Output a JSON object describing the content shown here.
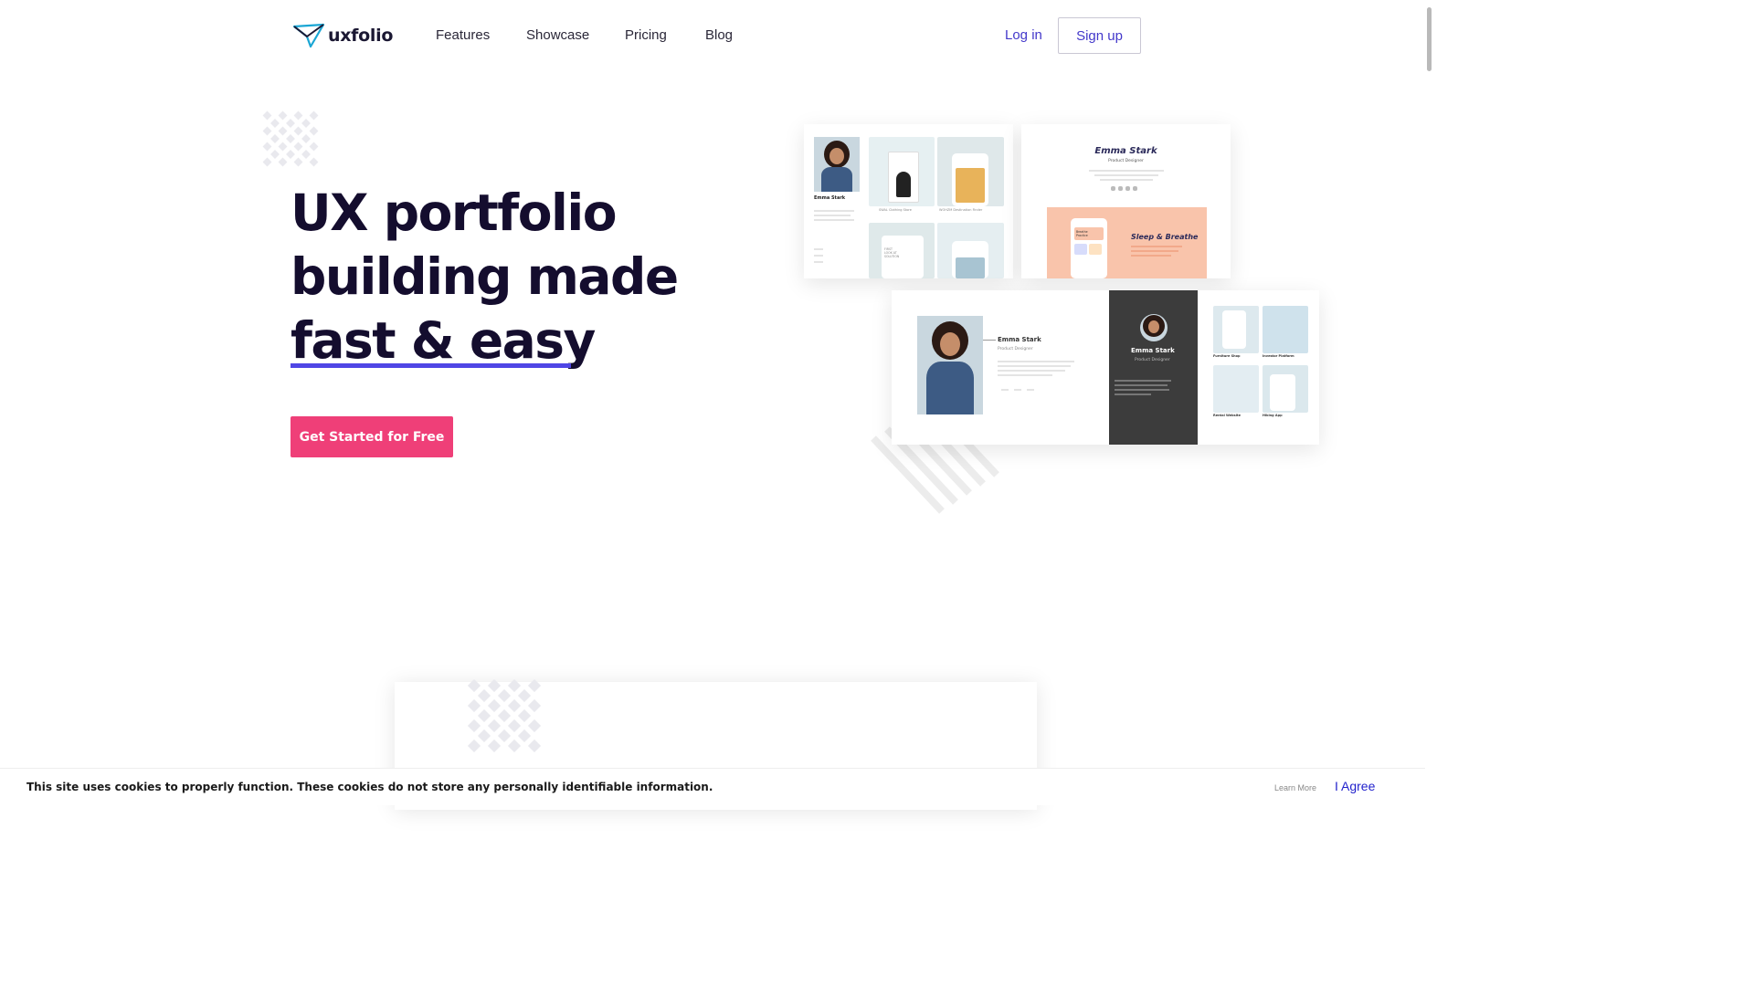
{
  "brand": {
    "name": "uxfolio",
    "logo_icon": "paper-plane-logo-icon",
    "accent": "#4f46e5",
    "cta_color": "#ef3f78",
    "logo_color": "#1aa6d4"
  },
  "nav": {
    "items": [
      {
        "label": "Features"
      },
      {
        "label": "Showcase"
      },
      {
        "label": "Pricing"
      },
      {
        "label": "Blog"
      }
    ],
    "login": "Log in",
    "signup": "Sign up"
  },
  "hero": {
    "title_lines": [
      "UX portfolio",
      "building made",
      "fast & easy"
    ],
    "cta": "Get Started for Free"
  },
  "mockups": {
    "card1": {
      "name": "Emma Stark",
      "caption_left": "SWAL Clothing Store",
      "caption_right": "WOHZM Destination Finder",
      "sidetext": "FIRST LOOK AT SOLUTION"
    },
    "card2": {
      "name": "Emma Stark",
      "role": "Product Designer",
      "project": "Sleep & Breathe",
      "app_label": "Breathe Practice"
    },
    "card3": {
      "name_light": "Emma Stark",
      "role_light": "Product Designer",
      "name_dark": "Emma Stark",
      "role_dark": "Product Designer",
      "projects": [
        "Furniture Shop",
        "Investor Platform",
        "Rental Website",
        "Hiking App"
      ]
    }
  },
  "cookie": {
    "message": "This site uses cookies to properly function. These cookies do not store any personally identifiable information.",
    "learn_more": "Learn More",
    "agree": "I Agree"
  }
}
